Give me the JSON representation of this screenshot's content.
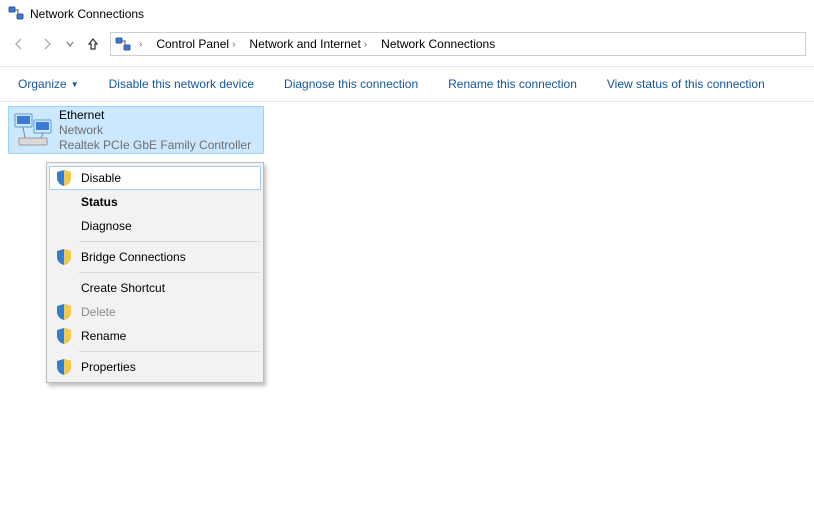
{
  "window": {
    "title": "Network Connections"
  },
  "breadcrumb": {
    "items": [
      {
        "label": "Control Panel"
      },
      {
        "label": "Network and Internet"
      },
      {
        "label": "Network Connections"
      }
    ]
  },
  "toolbar": {
    "organize": "Organize",
    "disable_device": "Disable this network device",
    "diagnose": "Diagnose this connection",
    "rename": "Rename this connection",
    "view_status": "View status of this connection"
  },
  "adapter": {
    "name": "Ethernet",
    "status": "Network",
    "device": "Realtek PCIe GbE Family Controller"
  },
  "context_menu": {
    "disable": "Disable",
    "status": "Status",
    "diagnose": "Diagnose",
    "bridge": "Bridge Connections",
    "create_shortcut": "Create Shortcut",
    "delete": "Delete",
    "rename": "Rename",
    "properties": "Properties"
  }
}
